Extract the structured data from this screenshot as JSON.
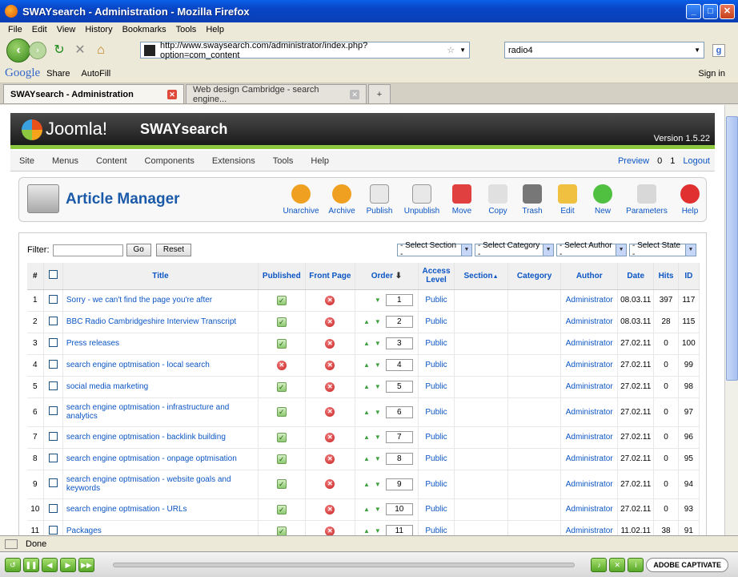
{
  "window": {
    "title": "SWAYsearch - Administration - Mozilla Firefox"
  },
  "menubar": [
    "File",
    "Edit",
    "View",
    "History",
    "Bookmarks",
    "Tools",
    "Help"
  ],
  "nav": {
    "url": "http://www.swaysearch.com/administrator/index.php?option=com_content",
    "search": "radio4"
  },
  "googlebar": {
    "logo": "Google",
    "share": "Share",
    "autofill": "AutoFill",
    "signin": "Sign in"
  },
  "tabs": [
    {
      "label": "SWAYsearch - Administration"
    },
    {
      "label": "Web design Cambridge - search engine..."
    }
  ],
  "joomla": {
    "logo": "Joomla!",
    "site": "SWAYsearch",
    "version": "Version 1.5.22"
  },
  "jmenu": [
    "Site",
    "Menus",
    "Content",
    "Components",
    "Extensions",
    "Tools",
    "Help"
  ],
  "jright": {
    "preview": "Preview",
    "msgs": "0",
    "users": "1",
    "logout": "Logout"
  },
  "page_title": "Article Manager",
  "toolbar": [
    "Unarchive",
    "Archive",
    "Publish",
    "Unpublish",
    "Move",
    "Copy",
    "Trash",
    "Edit",
    "New",
    "Parameters",
    "Help"
  ],
  "filter": {
    "label": "Filter:",
    "go": "Go",
    "reset": "Reset"
  },
  "selects": [
    "- Select Section -",
    "- Select Category -",
    "- Select Author -",
    "- Select State -"
  ],
  "columns": {
    "num": "#",
    "title": "Title",
    "published": "Published",
    "front": "Front Page",
    "order": "Order",
    "access": "Access Level",
    "section": "Section",
    "category": "Category",
    "author": "Author",
    "date": "Date",
    "hits": "Hits",
    "id": "ID"
  },
  "rows": [
    {
      "n": "1",
      "title": "Sorry - we can't find the page you're after",
      "pub": true,
      "order": "1",
      "access": "Public",
      "author": "Administrator",
      "date": "08.03.11",
      "hits": "397",
      "id": "117"
    },
    {
      "n": "2",
      "title": "BBC Radio Cambridgeshire Interview Transcript",
      "pub": true,
      "order": "2",
      "access": "Public",
      "author": "Administrator",
      "date": "08.03.11",
      "hits": "28",
      "id": "115"
    },
    {
      "n": "3",
      "title": "Press releases",
      "pub": true,
      "order": "3",
      "access": "Public",
      "author": "Administrator",
      "date": "27.02.11",
      "hits": "0",
      "id": "100"
    },
    {
      "n": "4",
      "title": "search engine optmisation - local search",
      "pub": false,
      "order": "4",
      "access": "Public",
      "author": "Administrator",
      "date": "27.02.11",
      "hits": "0",
      "id": "99"
    },
    {
      "n": "5",
      "title": "social media marketing",
      "pub": true,
      "order": "5",
      "access": "Public",
      "author": "Administrator",
      "date": "27.02.11",
      "hits": "0",
      "id": "98"
    },
    {
      "n": "6",
      "title": "search engine optmisation - infrastructure and analytics",
      "pub": true,
      "order": "6",
      "access": "Public",
      "author": "Administrator",
      "date": "27.02.11",
      "hits": "0",
      "id": "97"
    },
    {
      "n": "7",
      "title": "search engine optmisation - backlink building",
      "pub": true,
      "order": "7",
      "access": "Public",
      "author": "Administrator",
      "date": "27.02.11",
      "hits": "0",
      "id": "96"
    },
    {
      "n": "8",
      "title": "search engine optmisation - onpage optmisation",
      "pub": true,
      "order": "8",
      "access": "Public",
      "author": "Administrator",
      "date": "27.02.11",
      "hits": "0",
      "id": "95"
    },
    {
      "n": "9",
      "title": "search engine optmisation - website goals and keywords",
      "pub": true,
      "order": "9",
      "access": "Public",
      "author": "Administrator",
      "date": "27.02.11",
      "hits": "0",
      "id": "94"
    },
    {
      "n": "10",
      "title": "search engine optmisation - URLs",
      "pub": true,
      "order": "10",
      "access": "Public",
      "author": "Administrator",
      "date": "27.02.11",
      "hits": "0",
      "id": "93"
    },
    {
      "n": "11",
      "title": "Packages",
      "pub": true,
      "order": "11",
      "access": "Public",
      "author": "Administrator",
      "date": "11.02.11",
      "hits": "38",
      "id": "91"
    }
  ],
  "status": "Done",
  "captivate": "ADOBE CAPTIVATE"
}
